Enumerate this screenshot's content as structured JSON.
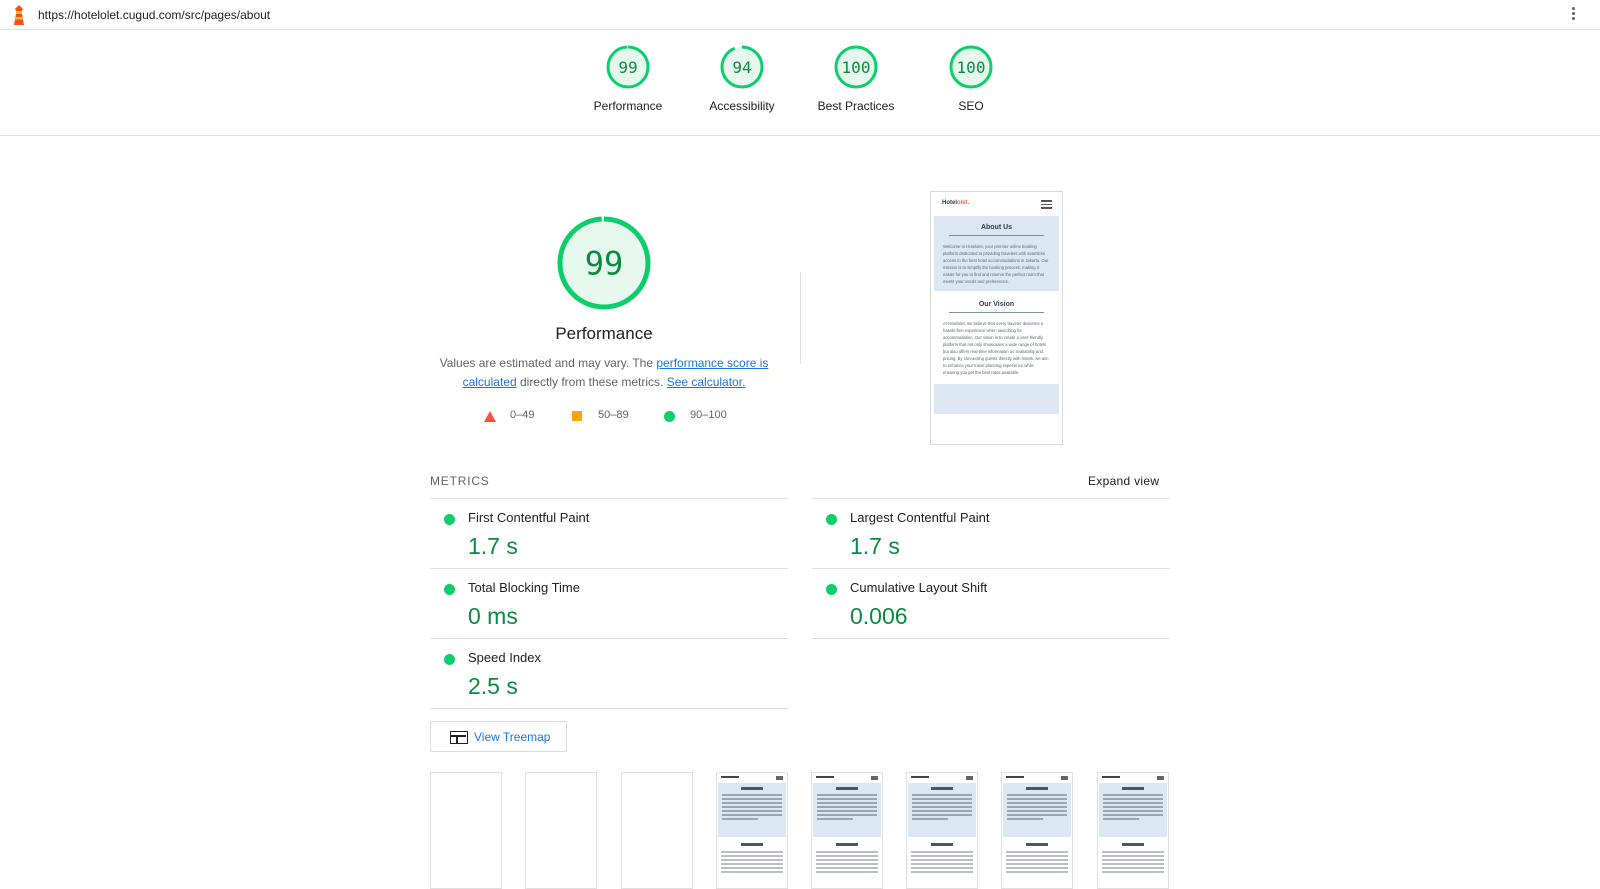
{
  "browser": {
    "url": "https://hotelolet.cugud.com/src/pages/about"
  },
  "scores": [
    {
      "value": "99",
      "label": "Performance",
      "fraction": 0.99
    },
    {
      "value": "94",
      "label": "Accessibility",
      "fraction": 0.94
    },
    {
      "value": "100",
      "label": "Best Practices",
      "fraction": 1.0
    },
    {
      "value": "100",
      "label": "SEO",
      "fraction": 1.0
    }
  ],
  "performance": {
    "score": "99",
    "score_fraction": 0.99,
    "title": "Performance",
    "desc_prefix": "Values are estimated and may vary. The ",
    "desc_link1": "performance score is calculated",
    "desc_mid": " directly from these metrics. ",
    "desc_link2": "See calculator.",
    "legend": [
      {
        "shape": "triangle",
        "range": "0–49",
        "color": "#ff4e42"
      },
      {
        "shape": "square",
        "range": "50–89",
        "color": "#ffa400"
      },
      {
        "shape": "circle",
        "range": "90–100",
        "color": "#0cce6b"
      }
    ]
  },
  "screenshot": {
    "brand_main": "Hotel",
    "brand_accent": "olet.",
    "about_title": "About Us",
    "about_text": "Welcome to Hotelolet, your premier online booking platform dedicated to providing travelers with seamless access to the best hotel accommodations in Jakarta. Our mission is to simplify the booking process, making it easier for you to find and reserve the perfect room that meets your needs and preferences.",
    "vision_title": "Our Vision",
    "vision_text": "At Hotelolet, we believe that every traveler deserves a hassle-free experience when searching for accommodation. Our vision is to create a user-friendly platform that not only showcases a wide range of hotels but also offers real-time information on availability and pricing. By connecting guests directly with hotels, we aim to enhance your travel planning experience while ensuring you get the best rates available."
  },
  "metrics": {
    "header": "METRICS",
    "expand_label": "Expand view",
    "items": [
      {
        "name": "First Contentful Paint",
        "value": "1.7 s"
      },
      {
        "name": "Largest Contentful Paint",
        "value": "1.7 s"
      },
      {
        "name": "Total Blocking Time",
        "value": "0 ms"
      },
      {
        "name": "Cumulative Layout Shift",
        "value": "0.006"
      },
      {
        "name": "Speed Index",
        "value": "2.5 s"
      }
    ]
  },
  "treemap": {
    "label": "View Treemap"
  },
  "colors": {
    "pass_green": "#0cce6b",
    "pass_text": "#0b8a40",
    "link_blue": "#1a73e8"
  }
}
